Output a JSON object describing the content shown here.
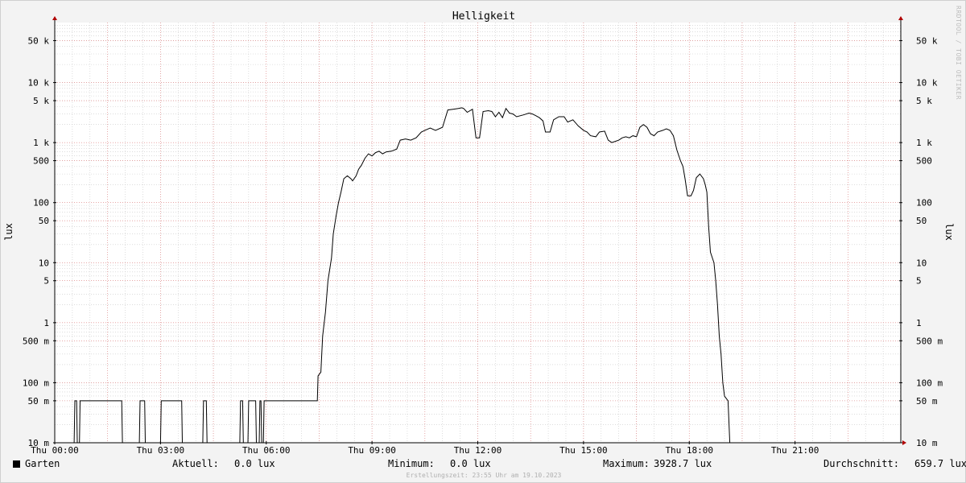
{
  "chart_data": {
    "type": "line",
    "title": "Helligkeit",
    "ylabel": "lux",
    "yscale": "log",
    "ylim": [
      0.01,
      100000
    ],
    "xlim": [
      0,
      24
    ],
    "grid": true,
    "x_ticks": [
      {
        "x": 0,
        "label": "Thu 00:00"
      },
      {
        "x": 3,
        "label": "Thu 03:00"
      },
      {
        "x": 6,
        "label": "Thu 06:00"
      },
      {
        "x": 9,
        "label": "Thu 09:00"
      },
      {
        "x": 12,
        "label": "Thu 12:00"
      },
      {
        "x": 15,
        "label": "Thu 15:00"
      },
      {
        "x": 18,
        "label": "Thu 18:00"
      },
      {
        "x": 21,
        "label": "Thu 21:00"
      }
    ],
    "y_ticks": [
      {
        "y": 0.01,
        "label": "10 m"
      },
      {
        "y": 0.05,
        "label": "50 m"
      },
      {
        "y": 0.1,
        "label": "100 m"
      },
      {
        "y": 0.5,
        "label": "500 m"
      },
      {
        "y": 1,
        "label": "1"
      },
      {
        "y": 5,
        "label": "5"
      },
      {
        "y": 10,
        "label": "10"
      },
      {
        "y": 50,
        "label": "50"
      },
      {
        "y": 100,
        "label": "100"
      },
      {
        "y": 500,
        "label": "500"
      },
      {
        "y": 1000,
        "label": "1 k"
      },
      {
        "y": 5000,
        "label": "5 k"
      },
      {
        "y": 10000,
        "label": "10 k"
      },
      {
        "y": 50000,
        "label": "50 k"
      }
    ],
    "series": [
      {
        "name": "Garten",
        "color": "#000000",
        "points": [
          [
            0.0,
            0.01
          ],
          [
            0.55,
            0.01
          ],
          [
            0.57,
            0.05
          ],
          [
            0.62,
            0.05
          ],
          [
            0.64,
            0.01
          ],
          [
            0.7,
            0.01
          ],
          [
            0.72,
            0.05
          ],
          [
            1.9,
            0.05
          ],
          [
            1.92,
            0.01
          ],
          [
            2.4,
            0.01
          ],
          [
            2.42,
            0.05
          ],
          [
            2.55,
            0.05
          ],
          [
            2.57,
            0.01
          ],
          [
            3.0,
            0.01
          ],
          [
            3.02,
            0.05
          ],
          [
            3.6,
            0.05
          ],
          [
            3.62,
            0.01
          ],
          [
            4.2,
            0.01
          ],
          [
            4.22,
            0.05
          ],
          [
            4.3,
            0.05
          ],
          [
            4.32,
            0.01
          ],
          [
            5.25,
            0.01
          ],
          [
            5.27,
            0.05
          ],
          [
            5.33,
            0.05
          ],
          [
            5.35,
            0.01
          ],
          [
            5.48,
            0.01
          ],
          [
            5.5,
            0.05
          ],
          [
            5.7,
            0.05
          ],
          [
            5.72,
            0.01
          ],
          [
            5.8,
            0.01
          ],
          [
            5.82,
            0.05
          ],
          [
            5.85,
            0.05
          ],
          [
            5.87,
            0.01
          ],
          [
            5.92,
            0.01
          ],
          [
            5.94,
            0.05
          ],
          [
            7.45,
            0.05
          ],
          [
            7.47,
            0.13
          ],
          [
            7.55,
            0.15
          ],
          [
            7.6,
            0.6
          ],
          [
            7.68,
            1.5
          ],
          [
            7.75,
            5
          ],
          [
            7.85,
            12
          ],
          [
            7.9,
            30
          ],
          [
            7.98,
            60
          ],
          [
            8.05,
            100
          ],
          [
            8.12,
            150
          ],
          [
            8.2,
            250
          ],
          [
            8.3,
            280
          ],
          [
            8.4,
            250
          ],
          [
            8.45,
            230
          ],
          [
            8.55,
            280
          ],
          [
            8.62,
            360
          ],
          [
            8.7,
            420
          ],
          [
            8.8,
            550
          ],
          [
            8.9,
            650
          ],
          [
            9.0,
            600
          ],
          [
            9.1,
            680
          ],
          [
            9.2,
            720
          ],
          [
            9.3,
            650
          ],
          [
            9.4,
            700
          ],
          [
            9.55,
            720
          ],
          [
            9.7,
            780
          ],
          [
            9.8,
            1100
          ],
          [
            9.95,
            1150
          ],
          [
            10.1,
            1100
          ],
          [
            10.25,
            1200
          ],
          [
            10.4,
            1500
          ],
          [
            10.5,
            1600
          ],
          [
            10.65,
            1750
          ],
          [
            10.8,
            1600
          ],
          [
            11.0,
            1800
          ],
          [
            11.15,
            3500
          ],
          [
            11.3,
            3600
          ],
          [
            11.45,
            3700
          ],
          [
            11.55,
            3800
          ],
          [
            11.6,
            3700
          ],
          [
            11.7,
            3200
          ],
          [
            11.85,
            3600
          ],
          [
            11.95,
            1200
          ],
          [
            12.05,
            1200
          ],
          [
            12.15,
            3300
          ],
          [
            12.3,
            3400
          ],
          [
            12.4,
            3300
          ],
          [
            12.5,
            2700
          ],
          [
            12.6,
            3200
          ],
          [
            12.7,
            2600
          ],
          [
            12.8,
            3700
          ],
          [
            12.9,
            3100
          ],
          [
            13.0,
            3000
          ],
          [
            13.1,
            2700
          ],
          [
            13.3,
            2900
          ],
          [
            13.45,
            3100
          ],
          [
            13.55,
            3000
          ],
          [
            13.65,
            2800
          ],
          [
            13.75,
            2600
          ],
          [
            13.85,
            2300
          ],
          [
            13.92,
            1500
          ],
          [
            14.05,
            1500
          ],
          [
            14.15,
            2400
          ],
          [
            14.3,
            2700
          ],
          [
            14.45,
            2700
          ],
          [
            14.55,
            2200
          ],
          [
            14.7,
            2400
          ],
          [
            14.85,
            1900
          ],
          [
            15.0,
            1600
          ],
          [
            15.1,
            1500
          ],
          [
            15.2,
            1300
          ],
          [
            15.35,
            1250
          ],
          [
            15.45,
            1500
          ],
          [
            15.6,
            1550
          ],
          [
            15.7,
            1100
          ],
          [
            15.8,
            1000
          ],
          [
            15.9,
            1050
          ],
          [
            16.0,
            1100
          ],
          [
            16.1,
            1200
          ],
          [
            16.2,
            1250
          ],
          [
            16.3,
            1200
          ],
          [
            16.4,
            1300
          ],
          [
            16.5,
            1250
          ],
          [
            16.6,
            1800
          ],
          [
            16.7,
            2000
          ],
          [
            16.8,
            1800
          ],
          [
            16.9,
            1400
          ],
          [
            17.0,
            1300
          ],
          [
            17.1,
            1500
          ],
          [
            17.25,
            1600
          ],
          [
            17.35,
            1700
          ],
          [
            17.45,
            1600
          ],
          [
            17.55,
            1300
          ],
          [
            17.65,
            750
          ],
          [
            17.75,
            500
          ],
          [
            17.82,
            400
          ],
          [
            17.88,
            250
          ],
          [
            17.95,
            130
          ],
          [
            18.05,
            130
          ],
          [
            18.12,
            160
          ],
          [
            18.2,
            260
          ],
          [
            18.3,
            300
          ],
          [
            18.4,
            250
          ],
          [
            18.45,
            200
          ],
          [
            18.5,
            150
          ],
          [
            18.55,
            40
          ],
          [
            18.6,
            15
          ],
          [
            18.7,
            10
          ],
          [
            18.75,
            5
          ],
          [
            18.8,
            2
          ],
          [
            18.85,
            0.6
          ],
          [
            18.9,
            0.3
          ],
          [
            18.95,
            0.1
          ],
          [
            19.0,
            0.06
          ],
          [
            19.1,
            0.05
          ],
          [
            19.15,
            0.01
          ],
          [
            24.0,
            0.01
          ]
        ]
      }
    ]
  },
  "legend": {
    "series_name": "Garten",
    "current_label": "Aktuell:",
    "current_value": "0.0 lux",
    "min_label": "Minimum:",
    "min_value": "0.0 lux",
    "max_label": "Maximum:",
    "max_value": "3928.7 lux",
    "avg_label": "Durchschnitt:",
    "avg_value": "659.7 lux"
  },
  "footer": "Erstellungszeit: 23:55 Uhr am 19.10.2023",
  "watermark": "RRDTOOL / TOBI OETIKER",
  "colors": {
    "background": "#f3f3f3",
    "plot_background": "#ffffff",
    "grid_major": "#e07a7a",
    "grid_minor": "#c8c8c8",
    "axis_arrow": "#b00000",
    "line": "#000000"
  }
}
